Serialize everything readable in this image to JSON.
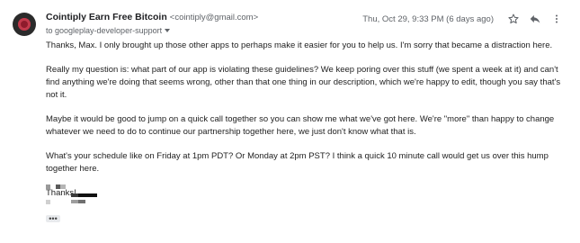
{
  "email": {
    "sender_name": "Cointiply Earn Free Bitcoin",
    "sender_email": "<cointiply@gmail.com>",
    "to": "to googleplay-developer-support",
    "date": "Thu, Oct 29, 9:33 PM (6 days ago)",
    "paragraphs": [
      "Thanks, Max. I only brought up those other apps to perhaps make it easier for you to help us. I'm sorry that became a distraction here.",
      "Really my question is: what part of our app is violating these guidelines? We keep poring over this stuff (we spent a week at it) and can't find anything we're doing that seems wrong, other than that one thing in our description, which we're happy to edit, though you say that's not it.",
      "Maybe it would be good to jump on a quick call together so you can show me what we've got here. We're \"more\" than happy to change whatever we need to do to continue our partnership together here, we just don't know what that is.",
      "What's your schedule like on Friday at 1pm PDT? Or Monday at 2pm PST? I think a quick 10 minute call would get us over this hump together here."
    ],
    "closing": "Thanks!",
    "trimmed_content": "•••"
  },
  "icons": {
    "star": "star-icon",
    "reply": "reply-icon",
    "more": "more-vert-icon",
    "caret": "caret-down-icon"
  }
}
